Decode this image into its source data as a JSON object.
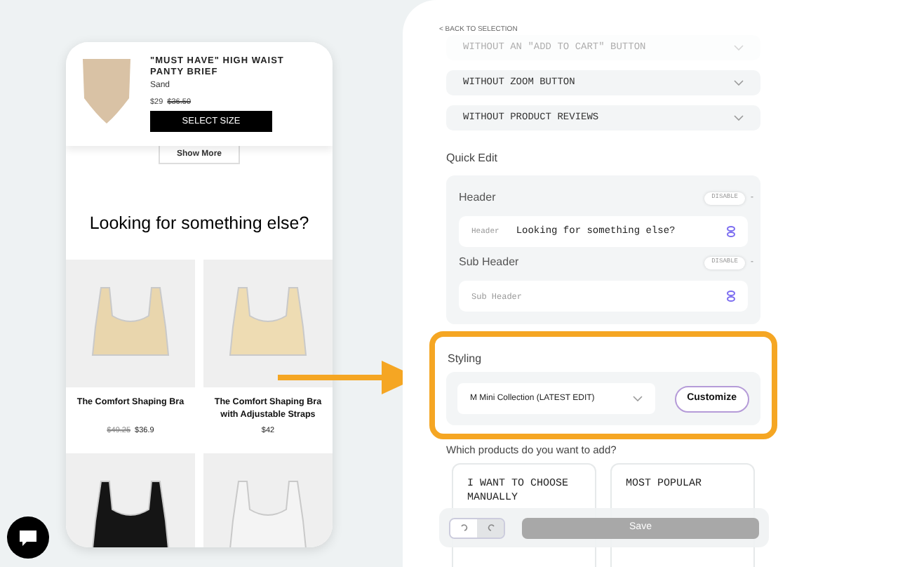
{
  "preview": {
    "cart_item": {
      "title": "\"MUST HAVE\" HIGH WAIST PANTY BRIEF",
      "variant": "Sand",
      "price": "$29",
      "old_price": "$36.50",
      "button": "SELECT SIZE"
    },
    "show_more": "Show More",
    "heading": "Looking for something else?",
    "products": [
      {
        "name": "The Comfort Shaping Bra",
        "old_price": "$49.25",
        "price": "$36.9"
      },
      {
        "name": "The Comfort Shaping Bra with Adjustable Straps",
        "price": "$42"
      }
    ]
  },
  "back_link": "< BACK TO SELECTION",
  "options": [
    {
      "label": "WITHOUT AN \"ADD TO CART\" BUTTON",
      "faded": true
    },
    {
      "label": "WITHOUT ZOOM BUTTON",
      "faded": false
    },
    {
      "label": "WITHOUT PRODUCT REVIEWS",
      "faded": false
    }
  ],
  "quick_edit": {
    "title": "Quick Edit",
    "fields": [
      {
        "label": "Header",
        "toggle": "DISABLE",
        "collapse": "-",
        "inline_label": "Header",
        "value": "Looking for something else?"
      },
      {
        "label": "Sub Header",
        "toggle": "DISABLE",
        "collapse": "-",
        "placeholder": "Sub Header"
      }
    ]
  },
  "styling": {
    "title": "Styling",
    "select": "M Mini Collection (LATEST EDIT)",
    "button": "Customize",
    "highlighted": true
  },
  "products_question": "Which products do you want to add?",
  "choices": [
    {
      "label": "I WANT TO CHOOSE MANUALLY"
    },
    {
      "label": "MOST POPULAR"
    }
  ],
  "toolbar": {
    "save": "Save",
    "undo_disabled": false,
    "redo_disabled": true
  }
}
